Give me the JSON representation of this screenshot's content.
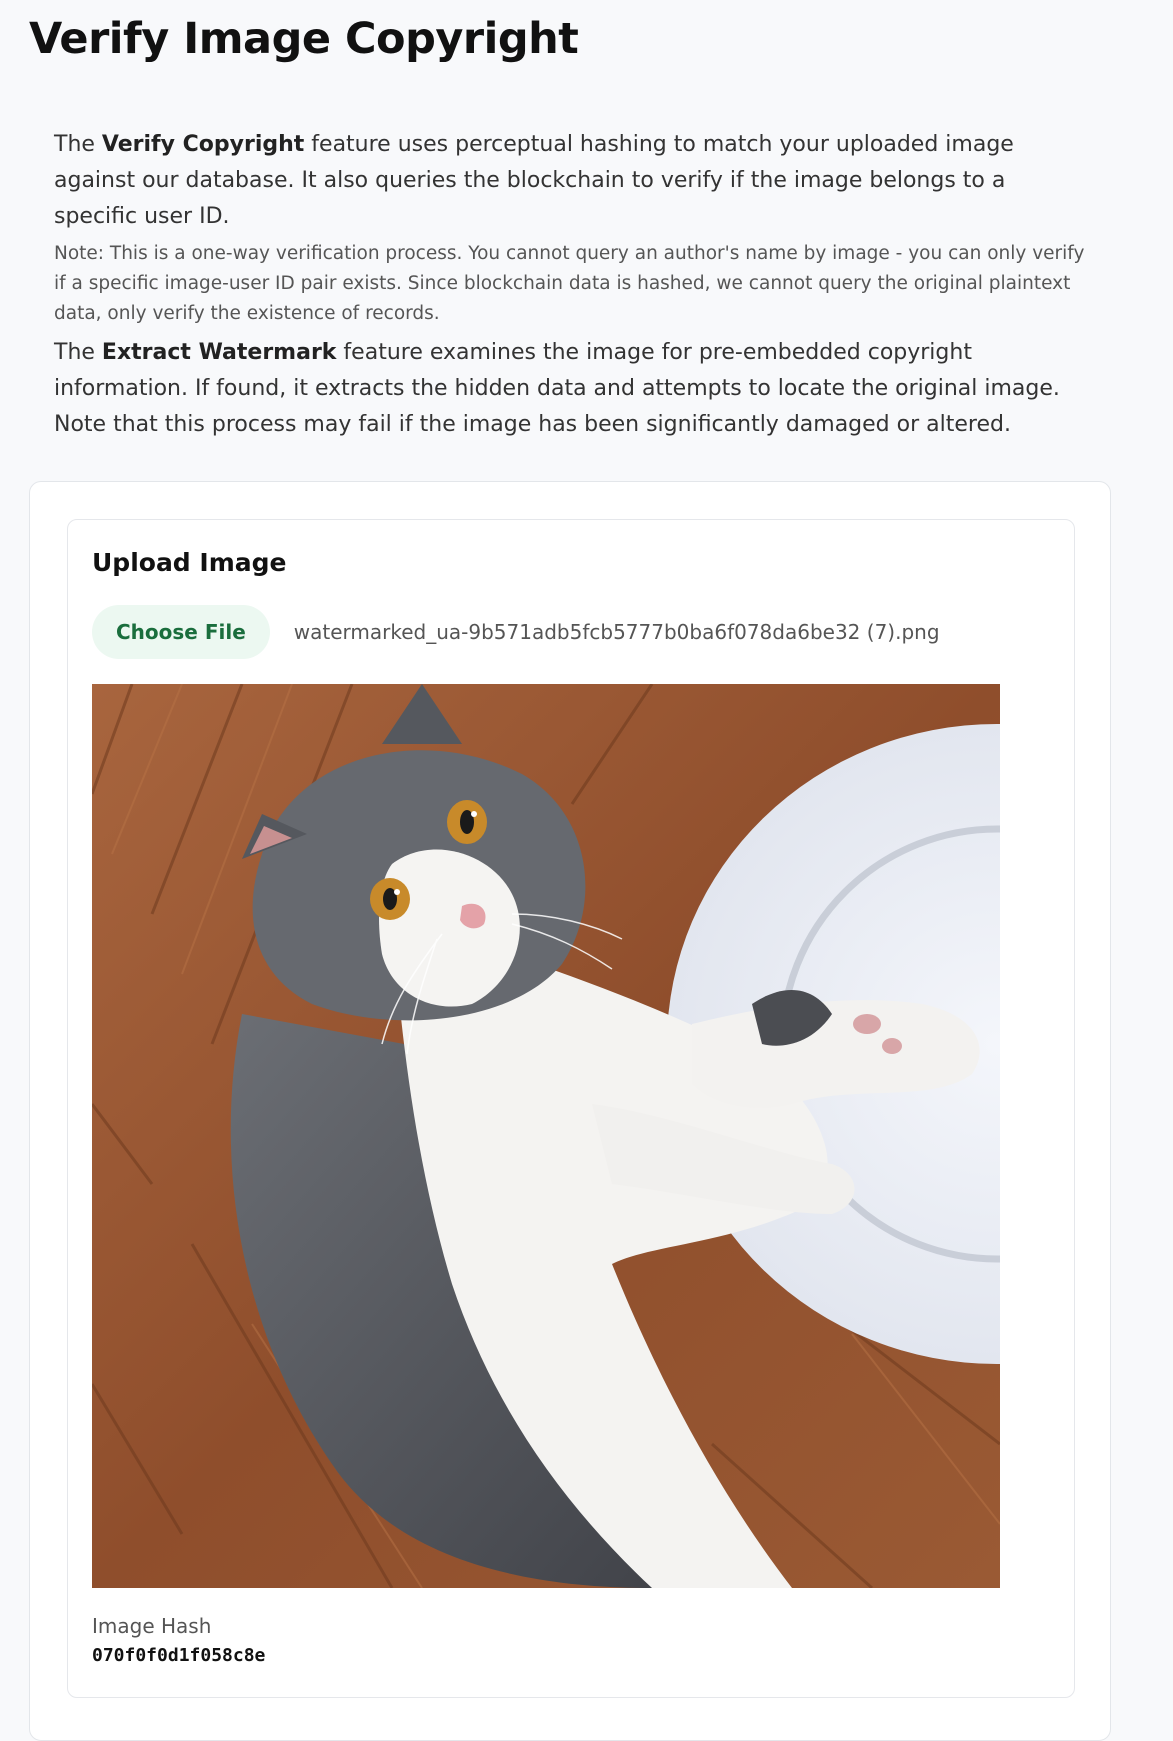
{
  "page": {
    "title": "Verify Image Copyright"
  },
  "intro": {
    "p1_prefix": "The ",
    "p1_bold": "Verify Copyright",
    "p1_suffix": " feature uses perceptual hashing to match your uploaded image against our database. It also queries the blockchain to verify if the image belongs to a specific user ID.",
    "note": "Note: This is a one-way verification process. You cannot query an author's name by image - you can only verify if a specific image-user ID pair exists. Since blockchain data is hashed, we cannot query the original plaintext data, only verify the existence of records.",
    "p2_prefix": "The ",
    "p2_bold": "Extract Watermark",
    "p2_suffix": " feature examines the image for pre-embedded copyright information. If found, it extracts the hidden data and attempts to locate the original image. Note that this process may fail if the image has been significantly damaged or altered."
  },
  "upload": {
    "title": "Upload Image",
    "choose_file_label": "Choose File",
    "file_name": "watermarked_ua-9b571adb5fcb5777b0ba6f078da6be32 (7).png",
    "hash_label": "Image Hash",
    "hash_value": "070f0f0d1f058c8e"
  },
  "colors": {
    "accent_green": "#1a6e3d",
    "button_bg": "#ecf8f1",
    "page_bg": "#f8f9fb"
  }
}
